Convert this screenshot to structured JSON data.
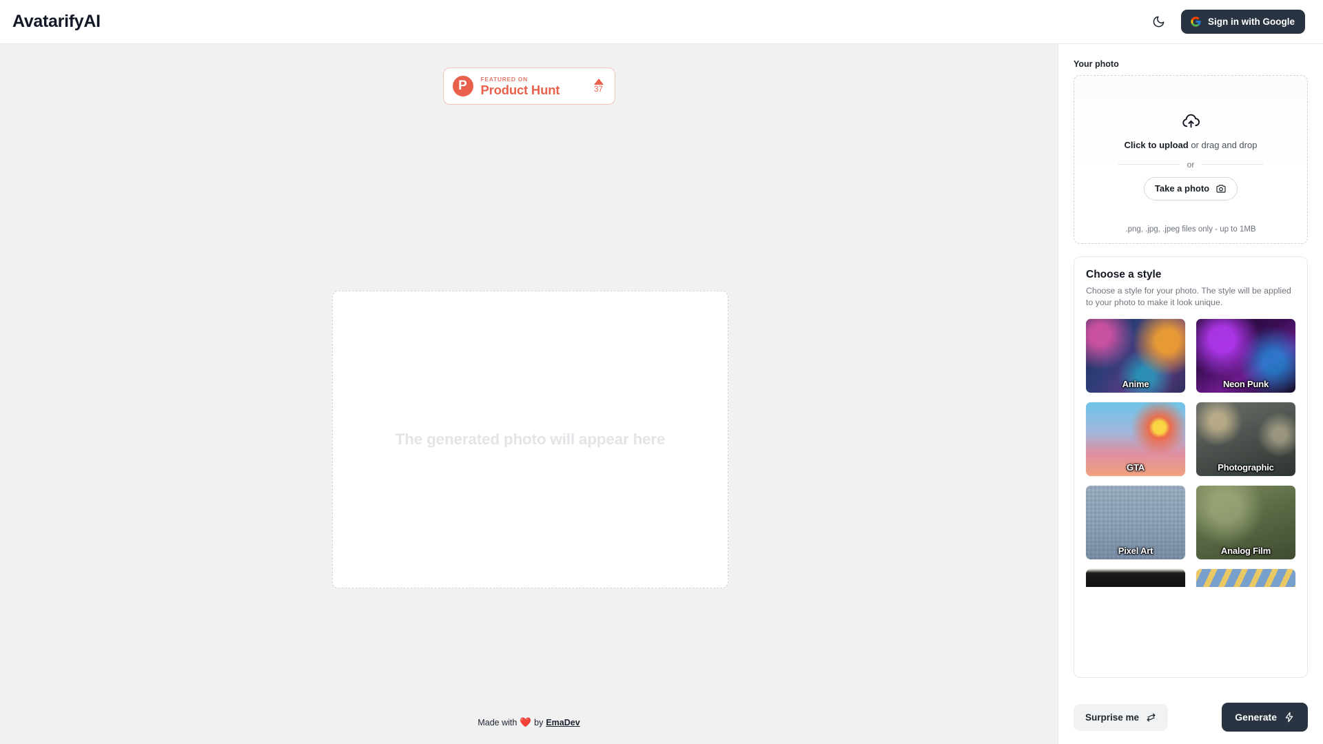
{
  "header": {
    "logo": "AvatarifyAI",
    "theme_toggle_icon": "moon-icon",
    "sign_in_label": "Sign in with Google"
  },
  "product_hunt": {
    "featured_on": "FEATURED ON",
    "name": "Product Hunt",
    "upvotes": "37",
    "accent_color": "#e9604c"
  },
  "canvas": {
    "placeholder": "The generated photo will appear here"
  },
  "footer": {
    "made_with": "Made with",
    "heart": "❤️",
    "by": "by",
    "author": "EmaDev"
  },
  "upload": {
    "label": "Your photo",
    "icon": "cloud-upload-icon",
    "click_to_upload": "Click to upload",
    "drag_and_drop": " or drag and drop",
    "or": "or",
    "take_photo_label": "Take a photo",
    "file_hint": ".png, .jpg, .jpeg files only - up to 1MB"
  },
  "style": {
    "title": "Choose a style",
    "description": "Choose a style for your photo. The style will be applied to your photo to make it look unique.",
    "items": [
      {
        "label": "Anime",
        "art": "art-anime"
      },
      {
        "label": "Neon Punk",
        "art": "art-neon"
      },
      {
        "label": "GTA",
        "art": "art-gta"
      },
      {
        "label": "Photographic",
        "art": "art-photo"
      },
      {
        "label": "Pixel Art",
        "art": "art-pixel"
      },
      {
        "label": "Analog Film",
        "art": "art-analog"
      },
      {
        "label": "",
        "art": "art-dark"
      },
      {
        "label": "",
        "art": "art-blue-gold"
      }
    ]
  },
  "actions": {
    "surprise_label": "Surprise me",
    "surprise_icon": "shuffle-icon",
    "generate_label": "Generate",
    "generate_icon": "lightning-icon",
    "generate_color": "#2a3341"
  }
}
